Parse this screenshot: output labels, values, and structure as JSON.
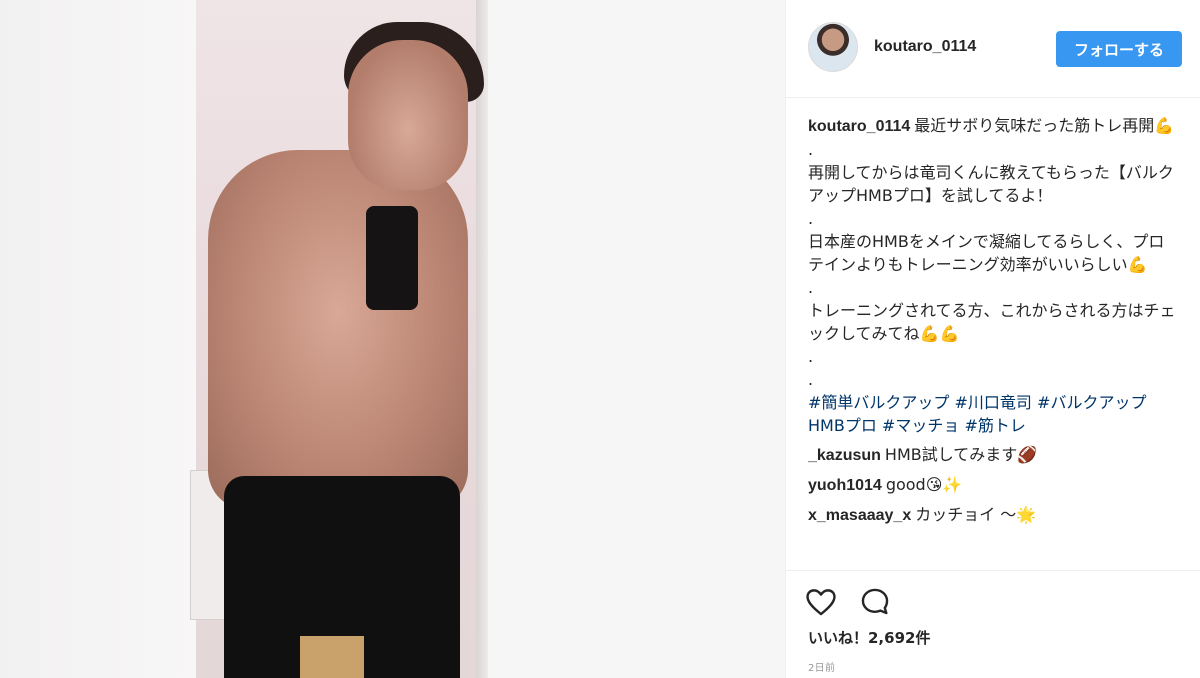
{
  "post": {
    "username": "koutaro_0114",
    "follow_label": "フォローする",
    "caption": {
      "lines": [
        "最近サボり気味だった筋トレ再開💪",
        ".",
        "再開してからは竜司くんに教えてもらった【バルクアップHMBプロ】を試してるよ！",
        ".",
        "日本産のHMBをメインで凝縮してるらしく、プロテインよりもトレーニング効率がいいらしい💪",
        ".",
        "トレーニングされてる方、これからされる方はチェックしてみてね💪💪",
        ".",
        "."
      ],
      "hashtags": [
        "#簡単バルクアップ",
        "#川口竜司",
        "#バルクアップHMBプロ",
        "#マッチョ",
        "#筋トレ"
      ]
    },
    "comments": [
      {
        "username": "_kazusun",
        "text": "HMB試してみます🏈"
      },
      {
        "username": "yuoh1014",
        "text": "good😘✨"
      },
      {
        "username": "x_masaaay_x",
        "text": "カッチョイ 〜🌟"
      }
    ],
    "likes_label": "いいね！2,692件",
    "time_label": "2日前"
  },
  "icons": {
    "like": "heart-outline-icon",
    "comment": "speech-bubble-icon"
  },
  "colors": {
    "follow_button": "#3897f0",
    "hashtag": "#003569",
    "text": "#262626",
    "muted": "#999999"
  }
}
